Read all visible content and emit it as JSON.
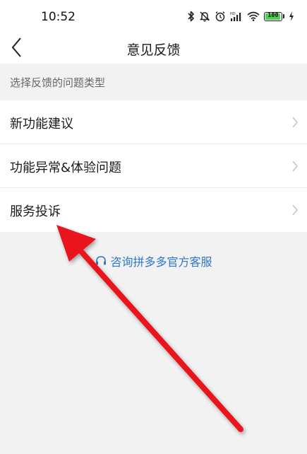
{
  "status_bar": {
    "time": "10:52",
    "battery": "100"
  },
  "nav": {
    "title": "意见反馈"
  },
  "section": {
    "header": "选择反馈的问题类型"
  },
  "feedback_types": [
    {
      "label": "新功能建议"
    },
    {
      "label": "功能异常&体验问题"
    },
    {
      "label": "服务投诉"
    }
  ],
  "support": {
    "label": "咨询拼多多官方客服"
  },
  "colors": {
    "accent": "#2f78c8",
    "annotation_arrow": "#e8161b",
    "background": "#f2f2f2"
  },
  "icons": [
    "bluetooth-icon",
    "mute-bell-icon",
    "alarm-icon",
    "signal-icon",
    "wifi-icon",
    "battery-icon",
    "charging-icon",
    "back-arrow-icon",
    "chevron-right-icon",
    "headset-icon"
  ]
}
